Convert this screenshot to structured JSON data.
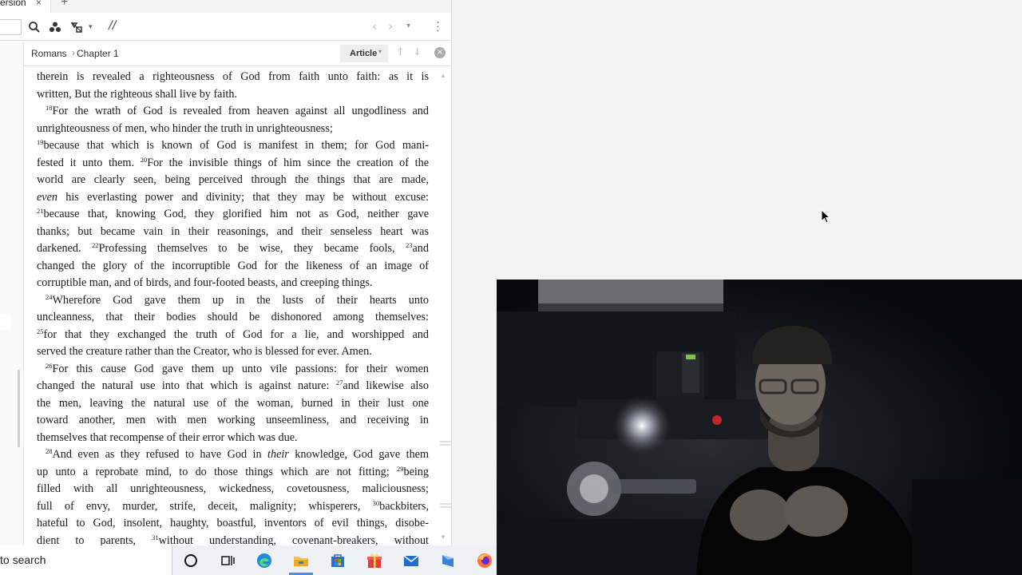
{
  "app": {
    "tab_label": "ersion",
    "tab_close": "×",
    "new_tab": "+",
    "toolbar": {
      "parallel_label": "//",
      "nav_back": "‹",
      "nav_forward": "›",
      "nav_dropdown": "▾",
      "more": "⋮"
    },
    "breadcrumb": {
      "book": "Romans",
      "separator": "›",
      "chapter": "Chapter 1"
    },
    "view_mode": "Article",
    "view_mode_caret": "▾",
    "prev_arrow": "↑",
    "next_arrow": "↓",
    "close_pane": "×"
  },
  "passage": {
    "book": "Romans",
    "chapter": 1,
    "lines": [
      [
        {
          "t": "therein is revealed a righteousness of God from faith unto faith: as it is"
        }
      ],
      [
        {
          "t": "written, But the righteous shall live by faith."
        }
      ],
      [
        {
          "v": "18"
        },
        {
          "t": "For the wrath of God is revealed from heaven against all ungodliness and"
        }
      ],
      [
        {
          "t": "unrighteousness of men, who hinder the truth in unrighteousness;"
        }
      ],
      [
        {
          "v": "19"
        },
        {
          "t": "because that which is known of God is manifest in them; for God mani-"
        }
      ],
      [
        {
          "t": "fested it unto them. "
        },
        {
          "v": "20"
        },
        {
          "t": "For the invisible things of him since the creation of the"
        }
      ],
      [
        {
          "t": "world are clearly seen, being perceived through the things that are made,"
        }
      ],
      [
        {
          "i": "even"
        },
        {
          "t": " his everlasting power and divinity; that they may be without excuse:"
        }
      ],
      [
        {
          "v": "21"
        },
        {
          "t": "because that, knowing God, they glorified him not as God, neither gave"
        }
      ],
      [
        {
          "t": "thanks; but became vain in their reasonings, and their senseless heart was"
        }
      ],
      [
        {
          "t": "darkened. "
        },
        {
          "v": "22"
        },
        {
          "t": "Professing themselves to be wise, they became fools, "
        },
        {
          "v": "23"
        },
        {
          "t": "and"
        }
      ],
      [
        {
          "t": "changed the glory of the incorruptible God for the likeness of an image of"
        }
      ],
      [
        {
          "t": "corruptible man, and of birds, and four-footed beasts, and creeping things."
        }
      ],
      [
        {
          "v": "24"
        },
        {
          "t": "Wherefore God gave them up in the lusts of their hearts unto"
        }
      ],
      [
        {
          "t": "uncleanness, that their bodies should be dishonored among themselves:"
        }
      ],
      [
        {
          "v": "25"
        },
        {
          "t": "for that they exchanged the truth of God for a lie, and worshipped and"
        }
      ],
      [
        {
          "t": "served the creature rather than the Creator, who is blessed for ever. Amen."
        }
      ],
      [
        {
          "v": "26"
        },
        {
          "t": "For this cause God gave them up unto vile passions: for their women"
        }
      ],
      [
        {
          "t": "changed the natural use into that which is against nature: "
        },
        {
          "v": "27"
        },
        {
          "t": "and likewise also"
        }
      ],
      [
        {
          "t": "the men, leaving the natural use of the woman, burned in their lust one"
        }
      ],
      [
        {
          "t": "toward another, men with men working unseemliness, and receiving in"
        }
      ],
      [
        {
          "t": "themselves that recompense of their error which was due."
        }
      ],
      [
        {
          "v": "28"
        },
        {
          "t": "And even as they refused to have God in "
        },
        {
          "i": "their"
        },
        {
          "t": " knowledge, God gave them"
        }
      ],
      [
        {
          "t": "up unto a reprobate mind, to do those things which are not fitting; "
        },
        {
          "v": "29"
        },
        {
          "t": "being"
        }
      ],
      [
        {
          "t": "filled with all unrighteousness, wickedness, covetousness, maliciousness;"
        }
      ],
      [
        {
          "t": "full of envy, murder, strife, deceit, malignity; whisperers, "
        },
        {
          "v": "30"
        },
        {
          "t": "backbiters,"
        }
      ],
      [
        {
          "t": "hateful to God, insolent, haughty, boastful, inventors of evil things, disobe-"
        }
      ],
      [
        {
          "t": "dient to parents, "
        },
        {
          "v": "31"
        },
        {
          "t": "without understanding, covenant-breakers, without"
        }
      ]
    ]
  },
  "taskbar": {
    "search_placeholder": "to search",
    "icons": [
      "cortana-circle-icon",
      "task-view-icon",
      "edge-icon",
      "file-explorer-icon",
      "store-icon",
      "gift-icon",
      "mail-icon",
      "app-icon",
      "firefox-icon"
    ]
  },
  "colors": {
    "accent": "#5a8bd6",
    "window_bg": "#ffffff",
    "desktop_bg": "#f3f3f3",
    "webcam_bg": "#0b0c10"
  }
}
